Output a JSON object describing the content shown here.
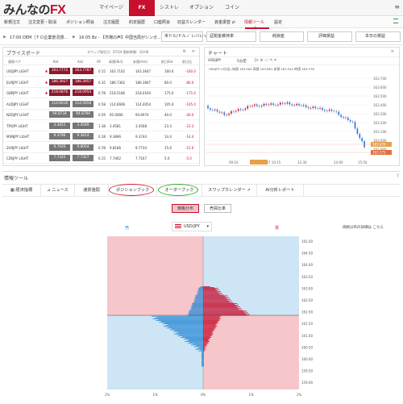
{
  "logo": {
    "text": "みんなの",
    "fx": "FX"
  },
  "top_tabs": [
    "マイページ",
    "FX",
    "シストレ",
    "オプション",
    "コイン"
  ],
  "menu": [
    "新規注文",
    "注文変更・取消",
    "ポジション照会",
    "注文履歴",
    "約定履歴",
    "口座照会",
    "収益カレンダー",
    "資金振替 ⇄",
    "情報ツール",
    "設定"
  ],
  "ticker": {
    "t1": "17:00 DEM［ＦＯ企業景況感...",
    "t2": "16:05 Bz - 【市場の声】中国当局がシンガ...",
    "leverage": "米ドル/ドルノ レバレッジ",
    "b1": "証拠金維持率",
    "b2": "純資産",
    "b3": "評価損益",
    "b4": "本日の損益"
  },
  "price_board": {
    "title": "プライスボード",
    "spread_note": "スワップ発生日：07/24 更新時間：16:06",
    "cols": [
      "通貨ペア",
      "Bid",
      "Ask",
      "SP",
      "高値(Bid)",
      "安値(Ask)",
      "前日Bid",
      "前日比"
    ],
    "rows": [
      {
        "pair": "USDJPY LIGHT",
        "bid": "163.7772",
        "ask": "163.7787",
        "sp": "0.15",
        "high": "163.7102",
        "low": "163.3647",
        "prev": "160.0",
        "chg": "-160.0"
      },
      {
        "pair": "EURJPY LIGHT",
        "bid": "186.3927",
        "ask": "186.3957",
        "sp": "0.35",
        "high": "186.7362",
        "low": "186.3667",
        "prev": "80.0",
        "chg": "-80.0"
      },
      {
        "pair": "GBPJPY LIGHT",
        "bid": "218.0876",
        "ask": "218.0954",
        "sp": "0.78",
        "high": "218.5186",
        "low": "218.0164",
        "prev": "175.0",
        "chg": "-175.0"
      },
      {
        "pair": "AUDJPY LIGHT",
        "bid": "114.6016",
        "ask": "114.5658",
        "sp": "0.58",
        "high": "114.6606",
        "low": "114.4054",
        "prev": "105.0",
        "chg": "-105.0"
      },
      {
        "pair": "NZDJPY LIGHT",
        "bid": "94.8734",
        "ask": "94.8784",
        "sp": "0.59",
        "high": "95.0066",
        "low": "94.6974",
        "prev": "40.0",
        "chg": "-40.0"
      },
      {
        "pair": "TRYJPY LIGHT",
        "bid": "3.4451",
        "ask": "3.4589",
        "sp": "1.38",
        "high": "3.4581",
        "low": "3.4568",
        "prev": "23.3",
        "chg": "-23.3"
      },
      {
        "pair": "MXNJPY LIGHT",
        "bid": "9.3796",
        "ask": "9.3814",
        "sp": "0.18",
        "high": "9.3896",
        "low": "9.3744",
        "prev": "14.4",
        "chg": "-14.4"
      },
      {
        "pair": "ZARJPY LIGHT",
        "bid": "9.7926",
        "ask": "9.8004",
        "sp": "0.78",
        "high": "9.8186",
        "low": "9.7734",
        "prev": "15.6",
        "chg": "-15.6"
      },
      {
        "pair": "CZKJPY LIGHT",
        "bid": "7.7322",
        "ask": "7.7327",
        "sp": "0.15",
        "high": "7.7462",
        "low": "7.7167",
        "prev": "5.0",
        "chg": "-5.0"
      }
    ]
  },
  "chart": {
    "title": "チャート",
    "pair": "USDJPY",
    "interval": "5分足",
    "ohlc": "USDJPY (5分足) 始値 163.564 高値 163.881 安値 163.544 終値 163.576",
    "y_ticks": [
      "163.700",
      "163.600",
      "163.500",
      "163.400",
      "163.300",
      "163.200",
      "163.100",
      "163.000",
      "162.900"
    ],
    "x_ticks": [
      "09:10",
      "07/27 10:15",
      "12:30",
      "14:00",
      "15:50"
    ],
    "last1": "163.429",
    "last2": "163.372"
  },
  "info_tool": {
    "title": "情報ツール",
    "tabs": [
      "経済指標",
      "ニュース",
      "通貨強弱",
      "ポジションブック",
      "オーダーブック",
      "スワップカレンダー",
      "AI分析レポート"
    ],
    "toggle": [
      "価格分布",
      "売買比率"
    ],
    "buy_label": "売",
    "sell_label": "買",
    "pair": "USD/JPY",
    "note": "価格分布の詳細は こちら",
    "y_ticks": [
      "165.00",
      "164.50",
      "164.00",
      "163.50",
      "163.00",
      "162.50",
      "162.00",
      "161.50",
      "161.00",
      "160.50",
      "160.00",
      "159.50",
      "159.00"
    ],
    "x_ticks": [
      "2%",
      "1%",
      "0%",
      "1%",
      "2%"
    ],
    "colors": {
      "sell": "#c8102e",
      "buy": "#2e8bd6",
      "bg_left": "#f7c6cb",
      "bg_right": "#cde5f5"
    }
  }
}
